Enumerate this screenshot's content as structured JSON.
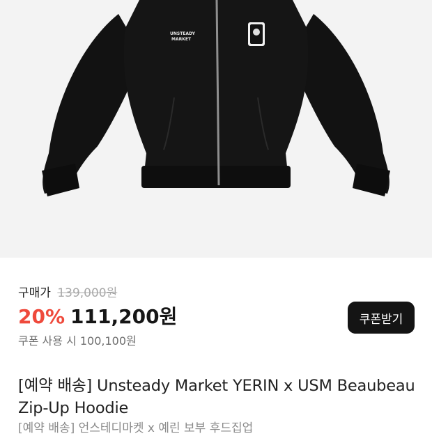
{
  "product": {
    "image_alt": "black zip-up hoodie",
    "chest_print": "UNSTEADY\nMARKET",
    "badge_icon": "rabbit-badge-icon"
  },
  "price": {
    "label": "구매가",
    "original": "139,000원",
    "discount_percent": "20%",
    "sale": "111,200원",
    "coupon_text": "쿠폰 사용 시 100,100원"
  },
  "coupon_button": {
    "label": "쿠폰받기"
  },
  "title": "[예약 배송] Unsteady Market YERIN x USM Beaubeau Zip-Up Hoodie",
  "subtitle": "[예약 배송] 언스테디마켓 x 예린 보부 후드집업",
  "colors": {
    "accent_red": "#ef4a3c",
    "button_bg": "#141414",
    "strike_gray": "#a8a8a8"
  }
}
